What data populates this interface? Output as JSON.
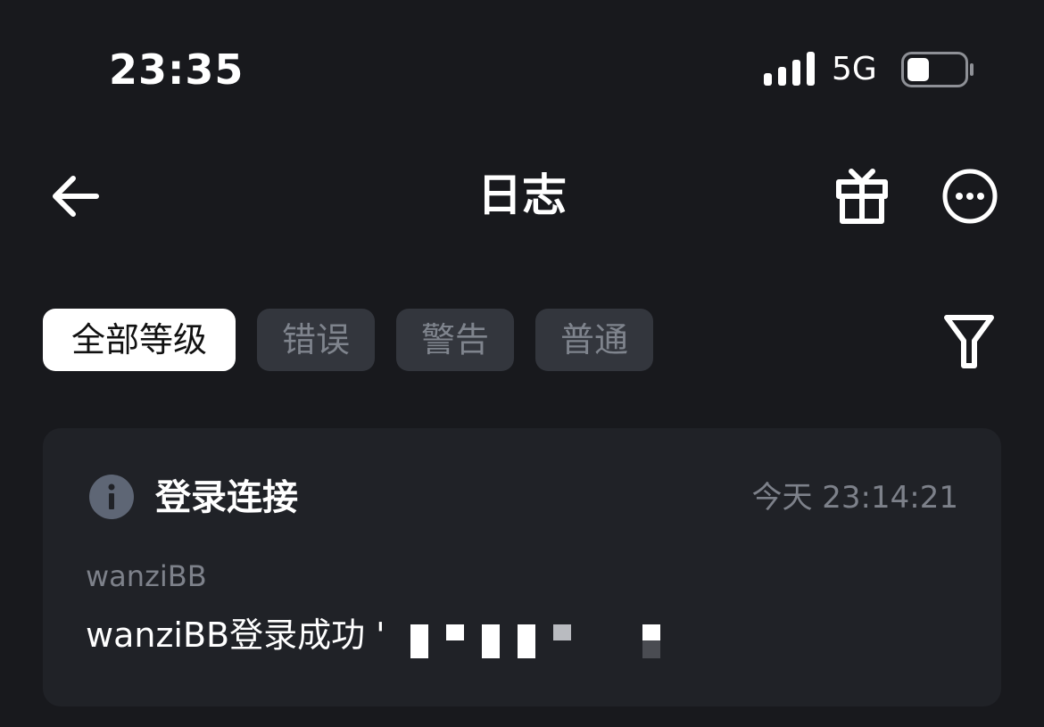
{
  "status_bar": {
    "time": "23:35",
    "network": "5G",
    "icons": [
      "signal-bars-icon",
      "battery-icon"
    ]
  },
  "nav": {
    "title": "日志",
    "icons": [
      "back-arrow-icon",
      "gift-icon",
      "more-icon"
    ]
  },
  "filters": {
    "chips": [
      {
        "label": "全部等级",
        "active": true
      },
      {
        "label": "错误",
        "active": false
      },
      {
        "label": "警告",
        "active": false
      },
      {
        "label": "普通",
        "active": false
      }
    ],
    "filter_icon": "funnel-icon"
  },
  "logs": [
    {
      "icon": "info-icon",
      "title": "登录连接",
      "time": "今天 23:14:21",
      "user": "wanziBB",
      "message": "wanziBB登录成功 '"
    }
  ],
  "colors": {
    "background": "#18191d",
    "card": "#202227",
    "chip_inactive": "#33363d",
    "chip_active": "#ffffff",
    "muted_text": "#7d818a"
  }
}
